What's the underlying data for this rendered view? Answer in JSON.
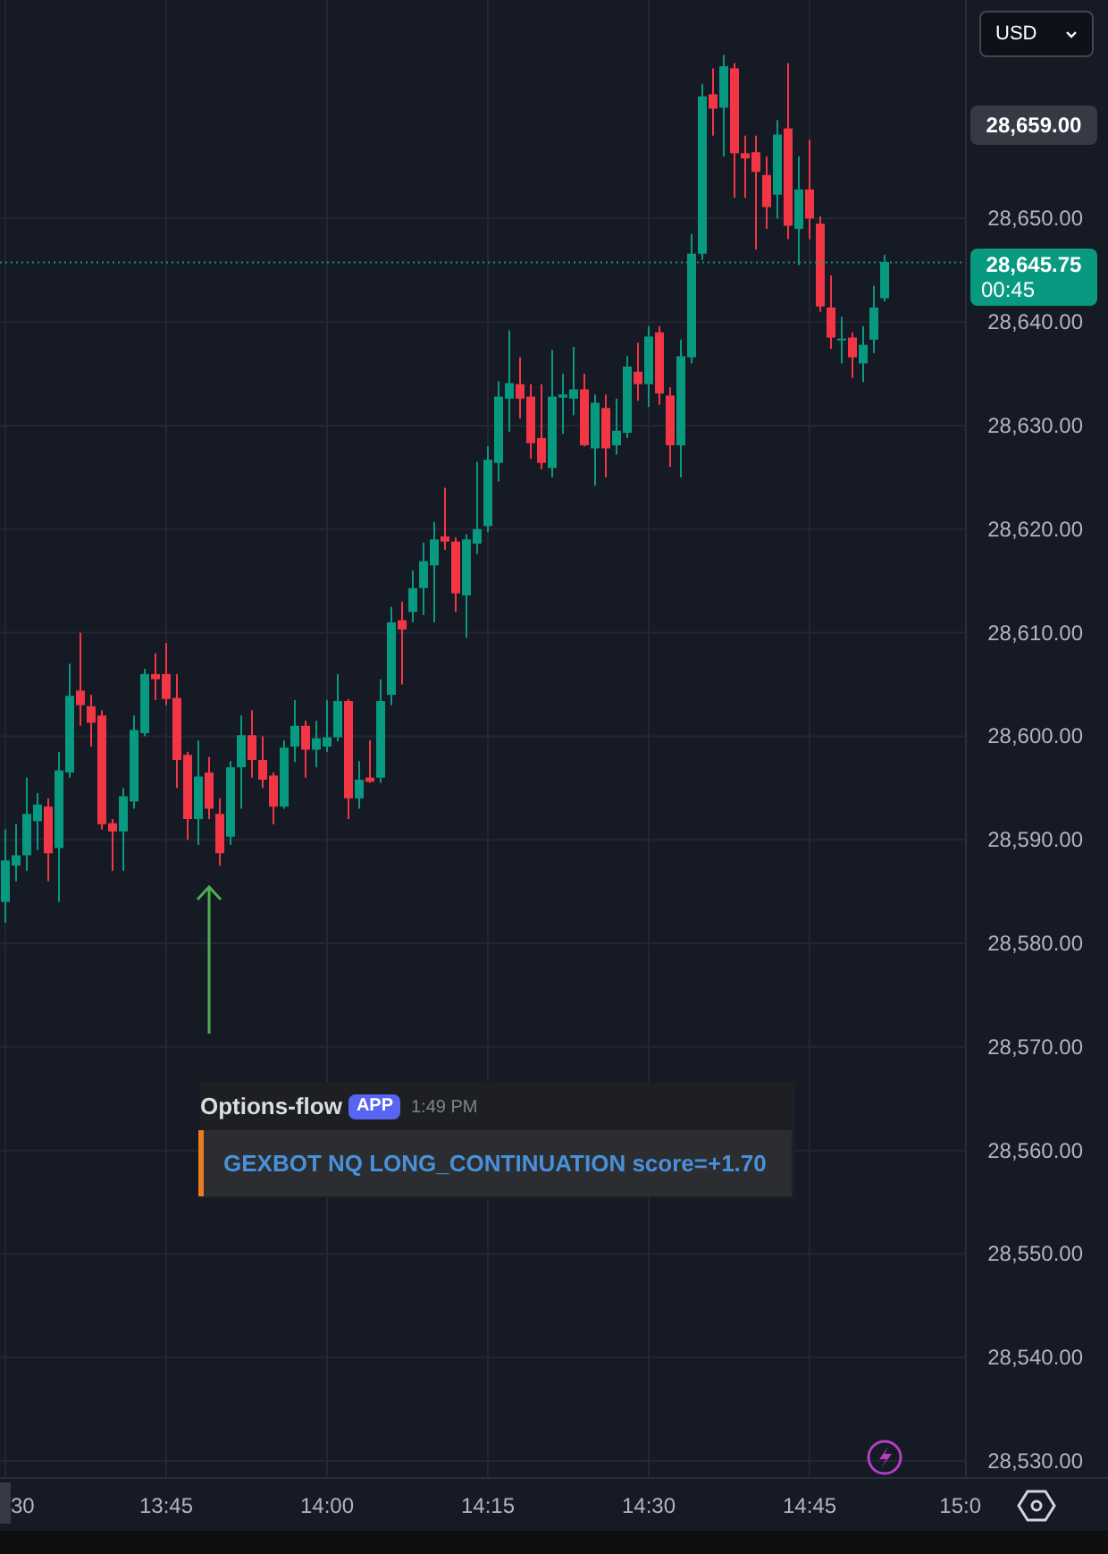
{
  "currency_selector": {
    "value": "USD"
  },
  "chart": {
    "chart_data": {
      "type": "candlestick",
      "ylim": [
        28528.45,
        28671.1
      ],
      "grid": true,
      "ref_lines": [
        {
          "axis": "y",
          "value": 28645.75,
          "color": "#089981"
        }
      ],
      "categories": [
        "30",
        null,
        null,
        null,
        null,
        null,
        null,
        null,
        null,
        null,
        null,
        null,
        null,
        null,
        null,
        "13:45",
        null,
        null,
        null,
        null,
        null,
        null,
        null,
        null,
        null,
        null,
        null,
        null,
        null,
        null,
        "14:00",
        null,
        null,
        null,
        null,
        null,
        null,
        null,
        null,
        null,
        null,
        null,
        null,
        null,
        null,
        "14:15",
        null,
        null,
        null,
        null,
        null,
        null,
        null,
        null,
        null,
        null,
        null,
        null,
        null,
        null,
        "14:30",
        null,
        null,
        null,
        null,
        null,
        null,
        null,
        null,
        null,
        null,
        null,
        null,
        null,
        null,
        "14:45",
        null,
        null,
        null,
        null,
        null,
        null,
        null,
        null,
        null,
        null,
        null,
        null,
        null,
        null,
        "15:0"
      ],
      "yticks": [
        {
          "value": 28650,
          "label": "28,650.00"
        },
        {
          "value": 28640,
          "label": "28,640.00"
        },
        {
          "value": 28630,
          "label": "28,630.00"
        },
        {
          "value": 28620,
          "label": "28,620.00"
        },
        {
          "value": 28610,
          "label": "28,610.00"
        },
        {
          "value": 28600,
          "label": "28,600.00"
        },
        {
          "value": 28590,
          "label": "28,590.00"
        },
        {
          "value": 28580,
          "label": "28,580.00"
        },
        {
          "value": 28570,
          "label": "28,570.00"
        },
        {
          "value": 28560,
          "label": "28,560.00"
        },
        {
          "value": 28550,
          "label": "28,550.00"
        },
        {
          "value": 28540,
          "label": "28,540.00"
        },
        {
          "value": 28530,
          "label": "28,530.00"
        }
      ],
      "ohlc": [
        [
          28584,
          28591,
          28582,
          28588
        ],
        [
          28587.5,
          28591.5,
          28586,
          28588.5
        ],
        [
          28588.5,
          28596,
          28587,
          28592.5
        ],
        [
          28591.8,
          28594.5,
          28589,
          28593.4
        ],
        [
          28593.2,
          28594,
          28586,
          28588.7
        ],
        [
          28589.2,
          28598.5,
          28584,
          28596.7
        ],
        [
          28596.5,
          28607,
          28596,
          28603.9
        ],
        [
          28604.4,
          28610,
          28601,
          28603
        ],
        [
          28602.9,
          28604,
          28599,
          28601.3
        ],
        [
          28602,
          28602.5,
          28591,
          28591.5
        ],
        [
          28591.6,
          28592,
          28587,
          28590.8
        ],
        [
          28590.8,
          28595,
          28587,
          28594.2
        ],
        [
          28593.7,
          28602,
          28593,
          28600.6
        ],
        [
          28600.3,
          28606.5,
          28600,
          28606
        ],
        [
          28606,
          28608,
          28603.5,
          28605.5
        ],
        [
          28606,
          28609,
          28603,
          28603.6
        ],
        [
          28603.7,
          28606,
          28595,
          28597.7
        ],
        [
          28598.2,
          28598.5,
          28590,
          28592
        ],
        [
          28592,
          28599.6,
          28589.5,
          28596.1
        ],
        [
          28596.5,
          28598,
          28592,
          28593
        ],
        [
          28592.5,
          28594,
          28587.5,
          28588.7
        ],
        [
          28590.3,
          28597.6,
          28589.5,
          28597
        ],
        [
          28597,
          28602,
          28593,
          28600.1
        ],
        [
          28600.1,
          28602.5,
          28596,
          28597.7
        ],
        [
          28597.7,
          28600,
          28595,
          28595.8
        ],
        [
          28596.2,
          28596.5,
          28591.5,
          28593.2
        ],
        [
          28593.2,
          28599.6,
          28593,
          28598.9
        ],
        [
          28599,
          28603.5,
          28597.5,
          28601
        ],
        [
          28601,
          28601.5,
          28596,
          28598.7
        ],
        [
          28598.7,
          28601.5,
          28597,
          28599.8
        ],
        [
          28599,
          28603.5,
          28598.5,
          28599.9
        ],
        [
          28599.9,
          28606,
          28599.5,
          28603.4
        ],
        [
          28603.4,
          28603.6,
          28592,
          28594
        ],
        [
          28594,
          28597.6,
          28593,
          28595.8
        ],
        [
          28596,
          28599.6,
          28595.5,
          28595.6
        ],
        [
          28596,
          28605.5,
          28595.5,
          28603.4
        ],
        [
          28604,
          28612.5,
          28603,
          28611
        ],
        [
          28611.2,
          28613,
          28605,
          28610.3
        ],
        [
          28612,
          28616,
          28611,
          28614.3
        ],
        [
          28614.3,
          28618.7,
          28611.7,
          28616.9
        ],
        [
          28616.5,
          28620.7,
          28611,
          28619
        ],
        [
          28619.3,
          28624,
          28618,
          28618.8
        ],
        [
          28618.8,
          28619.2,
          28612,
          28613.8
        ],
        [
          28613.6,
          28619.5,
          28609.5,
          28619
        ],
        [
          28618.6,
          28626.5,
          28617.6,
          28620
        ],
        [
          28620.3,
          28628,
          28619.7,
          28626.7
        ],
        [
          28626.4,
          28634.3,
          28624.6,
          28632.8
        ],
        [
          28632.6,
          28639.2,
          28629.4,
          28634.1
        ],
        [
          28634,
          28636.6,
          28630.7,
          28632.6
        ],
        [
          28632.8,
          28634,
          28626.8,
          28628.3
        ],
        [
          28628.8,
          28634,
          28625.8,
          28626.4
        ],
        [
          28625.9,
          28637.3,
          28625,
          28632.8
        ],
        [
          28632.7,
          28635,
          28629.2,
          28633
        ],
        [
          28632.6,
          28637.6,
          28631,
          28633.5
        ],
        [
          28633.5,
          28635,
          28628,
          28628.1
        ],
        [
          28627.8,
          28633,
          28624.2,
          28632.2
        ],
        [
          28631.7,
          28633,
          28625,
          28627.8
        ],
        [
          28628.1,
          28632.6,
          28627.2,
          28629.5
        ],
        [
          28629.3,
          28636.7,
          28628.8,
          28635.7
        ],
        [
          28635.2,
          28638,
          28632.4,
          28634
        ],
        [
          28634,
          28639.6,
          28631.8,
          28638.6
        ],
        [
          28639,
          28639.6,
          28632,
          28633.1
        ],
        [
          28632.9,
          28633.7,
          28626,
          28628.1
        ],
        [
          28628.1,
          28638.3,
          28625,
          28636.7
        ],
        [
          28636.6,
          28648.5,
          28636,
          28646.6
        ],
        [
          28646.6,
          28663,
          28646,
          28661.8
        ],
        [
          28662,
          28664.5,
          28658,
          28660.6
        ],
        [
          28660.7,
          28665.8,
          28656,
          28664.7
        ],
        [
          28664.5,
          28665,
          28652,
          28656.3
        ],
        [
          28656.3,
          28658,
          28652,
          28655.8
        ],
        [
          28656.4,
          28658,
          28647,
          28654.5
        ],
        [
          28654.2,
          28656,
          28649,
          28651.1
        ],
        [
          28652.3,
          28659.5,
          28650,
          28658.1
        ],
        [
          28658.7,
          28665,
          28648,
          28649.3
        ],
        [
          28649,
          28656,
          28645.5,
          28652.8
        ],
        [
          28652.8,
          28657.6,
          28648,
          28650
        ],
        [
          28649.5,
          28650.2,
          28641,
          28641.5
        ],
        [
          28641.4,
          28644.5,
          28637.4,
          28638.5
        ],
        [
          28638.3,
          28640.5,
          28636,
          28638.4
        ],
        [
          28638.5,
          28639,
          28634.6,
          28636.6
        ],
        [
          28636,
          28639.6,
          28634.2,
          28637.8
        ],
        [
          28638.3,
          28643.5,
          28637,
          28641.4
        ],
        [
          28642.3,
          28646.5,
          28642,
          28645.8
        ],
        null,
        null,
        null,
        null,
        null,
        null,
        null,
        null
      ]
    },
    "marker_price": "28,659.00",
    "last_price": {
      "price": "28,645.75",
      "countdown": "00:45"
    }
  },
  "message": {
    "author": "Options-flow",
    "badge": "APP",
    "time": "1:49 PM",
    "text": "GEXBOT NQ LONG_CONTINUATION score=+1.70"
  }
}
